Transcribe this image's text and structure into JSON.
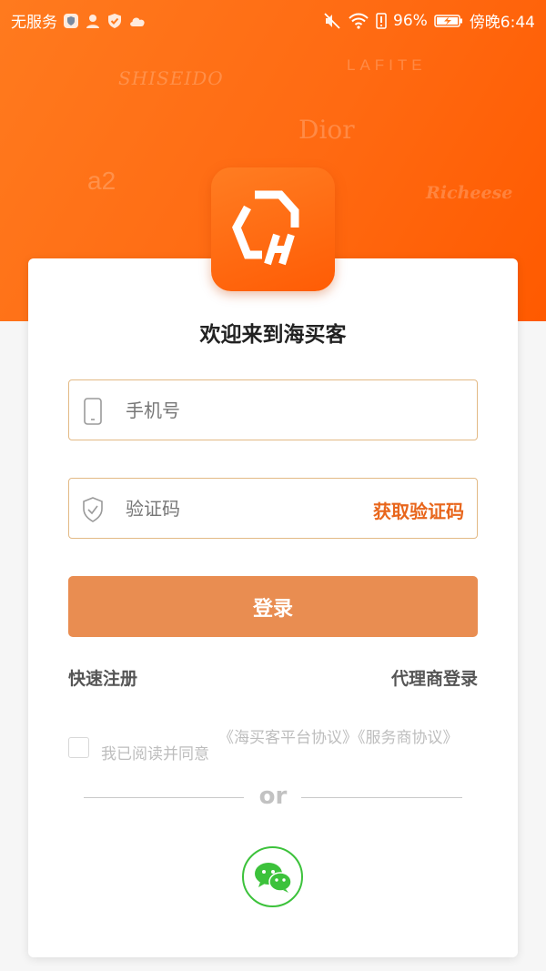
{
  "status_bar": {
    "carrier": "无服务",
    "battery": "96%",
    "time": "傍晚6:44"
  },
  "brands": {
    "shiseido": "SHISEIDO",
    "lafite": "LAFITE",
    "dior": "Dior",
    "a2": "a2",
    "richeese": "Richeese"
  },
  "login": {
    "welcome": "欢迎来到海买客",
    "phone_placeholder": "手机号",
    "code_placeholder": "验证码",
    "get_code": "获取验证码",
    "login_button": "登录",
    "register_link": "快速注册",
    "agent_login_link": "代理商登录",
    "agree_prefix": "我已阅读并同意",
    "agree_links": "《海买客平台协议》《服务商协议》",
    "or_text": "or"
  },
  "colors": {
    "brand_orange": "#ff6a12",
    "button_orange": "#e98d51",
    "link_orange": "#e8661c",
    "wechat_green": "#3cc23b"
  },
  "icons": {
    "status_left": [
      "shield-icon",
      "person-icon",
      "check-shield-icon",
      "cloud-icon"
    ],
    "status_right": [
      "mute-icon",
      "wifi-icon",
      "battery-icon"
    ],
    "phone_field": "phone-icon",
    "code_field": "shield-check-icon",
    "social": "wechat-icon"
  }
}
